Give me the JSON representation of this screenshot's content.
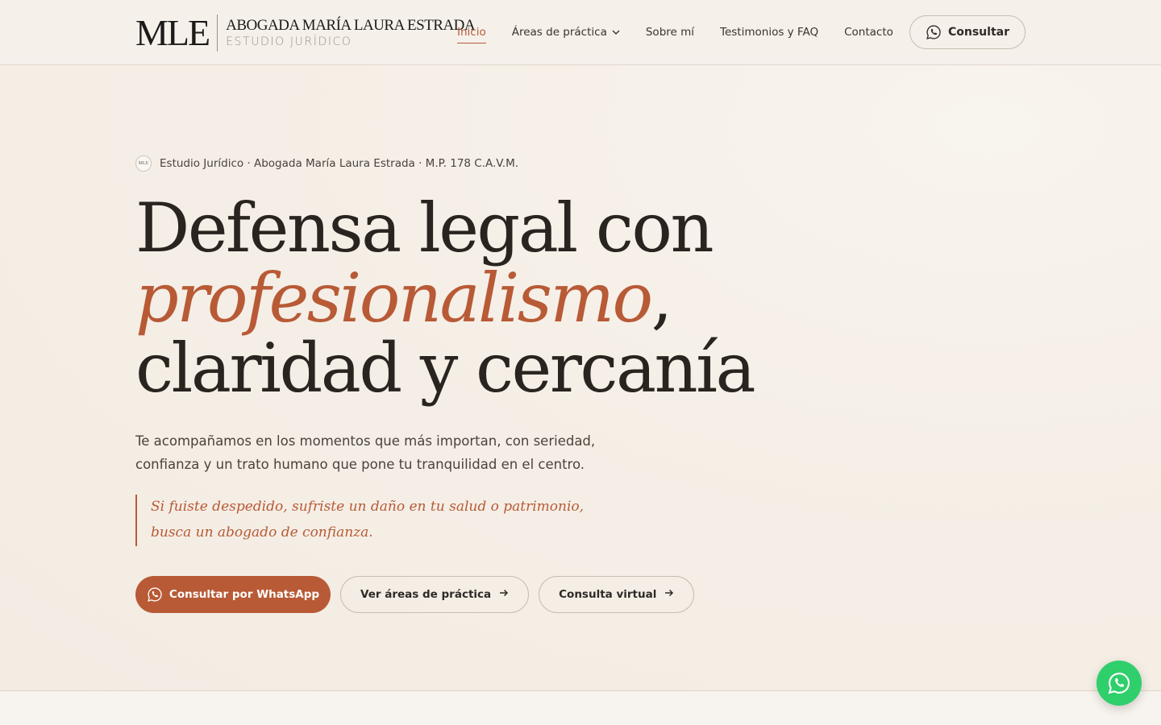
{
  "header": {
    "logo_mark": "MLE",
    "logo_name": "ABOGADA MARÍA LAURA ESTRADA",
    "logo_sub": "ESTUDIO JURÍDICO",
    "nav": [
      {
        "label": "Inicio",
        "active": true
      },
      {
        "label": "Áreas de práctica",
        "dropdown": true
      },
      {
        "label": "Sobre mí"
      },
      {
        "label": "Testimonios y FAQ"
      },
      {
        "label": "Contacto"
      }
    ],
    "cta_label": "Consultar"
  },
  "hero": {
    "badge": "MLE",
    "eyebrow": "Estudio Jurídico · Abogada María Laura Estrada · M.P. 178 C.A.V.M.",
    "title_line1": "Defensa legal con",
    "title_accent": "profesionalismo",
    "title_comma": ",",
    "title_line3": "claridad y cercanía",
    "lead": "Te acompañamos en los momentos que más importan, con seriedad, confianza y un trato humano que pone tu tranquilidad en el centro.",
    "quote_line1": "Si fuiste despedido, sufriste un daño en tu salud o patrimonio,",
    "quote_line2": "busca un abogado de confianza.",
    "btn_whatsapp": "Consultar por WhatsApp",
    "btn_areas": "Ver áreas de práctica",
    "btn_virtual": "Consulta virtual"
  },
  "colors": {
    "accent": "#b85a36",
    "background": "#f4eee6",
    "whatsapp": "#2fcf6b"
  },
  "icons": [
    "whatsapp-icon",
    "chevron-down-icon",
    "arrow-right-icon"
  ]
}
